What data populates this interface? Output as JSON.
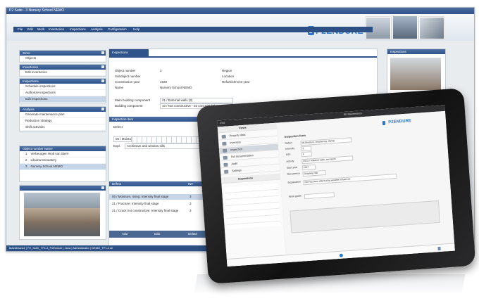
{
  "window": {
    "title": "P2 Suite - 3 Nursery School NEMO",
    "tabs": [
      "Administration",
      "Maintenance",
      "Risk Inspection",
      "Project",
      "Administration"
    ],
    "menu": [
      "File",
      "Edit",
      "Work",
      "Inventories",
      "Inspections",
      "Analysis",
      "Configuration",
      "Help"
    ],
    "logo": "P2ENDURE",
    "status": "Maintenance | P2_Suite_TP1.4_P2Endure | Jana | Administrator | DEMO_TP1.4 all"
  },
  "sidebar": {
    "store": {
      "header": "Store",
      "items": [
        "Objects"
      ]
    },
    "inventories": {
      "header": "Inventories",
      "items": [
        "Edit inventories"
      ]
    },
    "inspections": {
      "header": "Inspections",
      "items": [
        "Schedule inspections",
        "Authorize inspections",
        "Edit inspections"
      ]
    },
    "analysis": {
      "header": "Analysis",
      "items": [
        "Generate maintenance plan",
        "Reduction strategy",
        "Shift activities"
      ]
    },
    "objects": {
      "header": "Object number  Name",
      "rows": [
        {
          "num": "1",
          "name": "Verbeurgen Wolt van Stern"
        },
        {
          "num": "2",
          "name": "Libuina Monastery"
        },
        {
          "num": "3",
          "name": "Nursery School NEMO"
        }
      ]
    }
  },
  "inspections_panel": {
    "tab": "Inspections",
    "fields": [
      {
        "label": "Object number",
        "value": "3"
      },
      {
        "label": "Subobject number",
        "value": ""
      },
      {
        "label": "Construction year",
        "value": "1928"
      },
      {
        "label": "Name",
        "value": "Nursery School NEMO"
      }
    ],
    "right_fields": [
      "Region",
      "Location",
      "Refurbishment year"
    ],
    "component": {
      "main_label": "Main building component",
      "main_value": "21 / External walls (3)",
      "building_label": "Building component",
      "building_value": "10 / Not constructive - 02 concrete (3)"
    },
    "inspection_header": "Inspection item",
    "defect_label": "Defect",
    "defect_value": "05 / Moisture",
    "expl_label": "Expl.",
    "expl_value": "Architrave and window sills",
    "defects_header": {
      "defect": "Defect",
      "int": "INT",
      "ext": "EXT"
    },
    "defects": [
      {
        "text": "05 / Moisture, rising: Intensity final stage",
        "int": "3",
        "ext": "3"
      },
      {
        "text": "21 / Fracture: Intensity final stage",
        "int": "3",
        "ext": "1"
      },
      {
        "text": "21 / Crack not constructive: Intensity final stage",
        "int": "3",
        "ext": "3"
      }
    ],
    "buttons": [
      "Add",
      "Edit",
      "Delete"
    ]
  },
  "right_column": {
    "header": "Inspections"
  },
  "tablet": {
    "top_left": "iPad",
    "top_title": "BE Maintenance",
    "sidebar_header": "Views",
    "menu": [
      "Property data",
      "Inventory",
      "Inspection",
      "Full documentation",
      "Audit",
      "Settings"
    ],
    "sub_header": "Inspections",
    "form_title": "Inspection form",
    "form_labels": [
      "Defect",
      "Intensity",
      "Size",
      "Activity",
      "Start year",
      "Recurrence",
      "Repetit. last year",
      "Total"
    ],
    "form_values": [
      "05-Moisture, weathering, drying",
      "3",
      "1",
      "R131 / Material walls, wet spots",
      "2017",
      "Ongoing year",
      "1"
    ],
    "note_label": "Explanation",
    "note_value": "Not has been affected by weather influences",
    "bottom_label": "Work grade",
    "logo": "P2ENDURE"
  }
}
